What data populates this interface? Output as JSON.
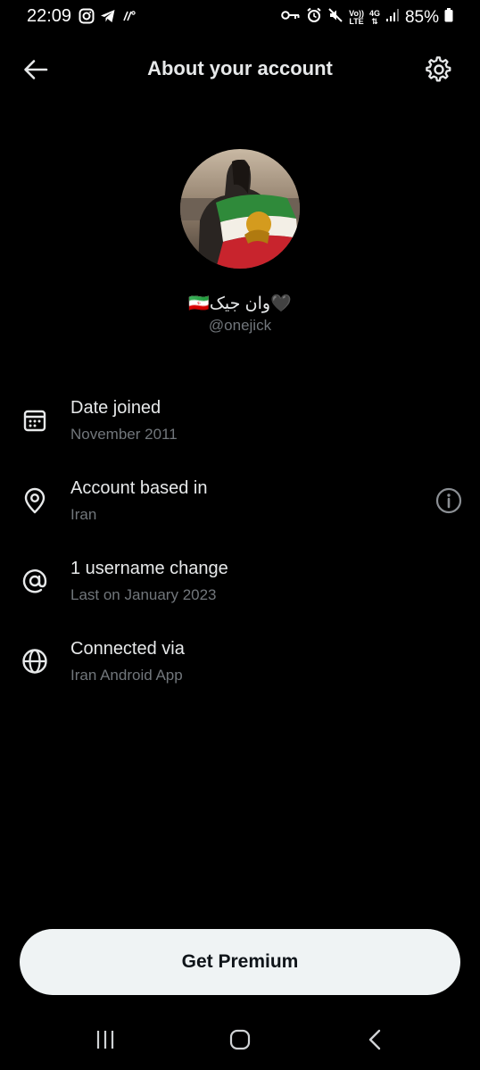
{
  "status_bar": {
    "time": "22:09",
    "battery_text": "85%",
    "left_icons": [
      "instagram-icon",
      "telegram-icon",
      "signal-hd-icon"
    ],
    "right_icons": [
      "vpn-key-icon",
      "alarm-icon",
      "mute-icon",
      "volte-icon",
      "4g-icon",
      "signal-icon",
      "battery-icon"
    ],
    "volte_line1": "Vo))",
    "volte_line2": "LTE",
    "network_4g": "4G"
  },
  "header": {
    "title": "About your account",
    "back_icon": "arrow-left-icon",
    "settings_icon": "gear-icon"
  },
  "profile": {
    "display_name": "🇮🇷وان جیک🖤",
    "handle": "@onejick"
  },
  "info_items": [
    {
      "icon": "calendar-icon",
      "title": "Date joined",
      "subtitle": "November 2011"
    },
    {
      "icon": "location-pin-icon",
      "title": "Account based in",
      "subtitle": "Iran",
      "extra_icon": "info-icon"
    },
    {
      "icon": "at-sign-icon",
      "title": "1 username change",
      "subtitle": "Last on January 2023"
    },
    {
      "icon": "globe-icon",
      "title": "Connected via",
      "subtitle": "Iran Android App"
    }
  ],
  "premium_button": {
    "label": "Get Premium"
  },
  "nav_bar": {
    "icons": [
      "recent-apps-icon",
      "home-icon",
      "back-icon"
    ]
  },
  "colors": {
    "background": "#000000",
    "primary_text": "#e7e9ea",
    "secondary_text": "#71767b",
    "button_bg": "#eff3f4",
    "button_text": "#0f1419"
  }
}
